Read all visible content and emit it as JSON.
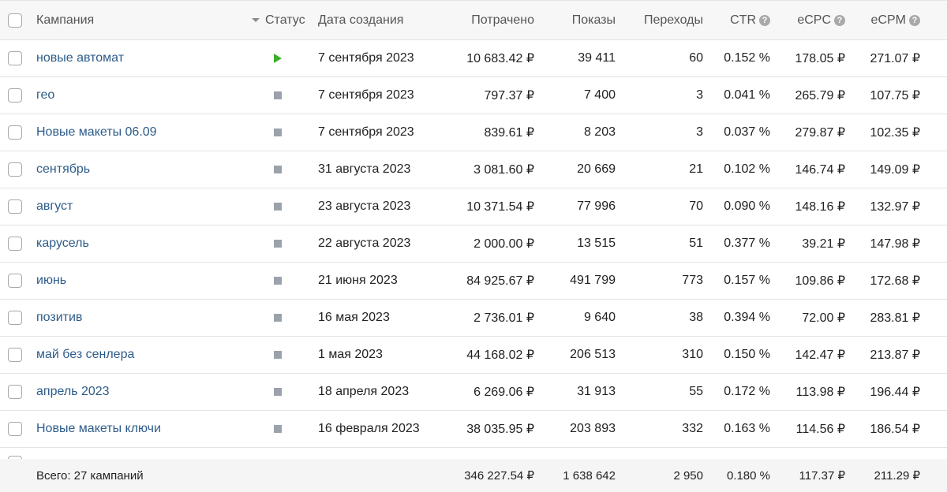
{
  "header": {
    "campaign": "Кампания",
    "status": "Статус",
    "date": "Дата создания",
    "spent": "Потрачено",
    "impressions": "Показы",
    "clicks": "Переходы",
    "ctr": "CTR",
    "ecpc": "eCPC",
    "ecpm": "eCPM",
    "help_glyph": "?"
  },
  "rows": [
    {
      "name": "новые автомат",
      "status": "play",
      "date": "7 сентября 2023",
      "spent": "10 683.42 ₽",
      "impressions": "39 411",
      "clicks": "60",
      "ctr": "0.152 %",
      "ecpc": "178.05 ₽",
      "ecpm": "271.07 ₽"
    },
    {
      "name": "гео",
      "status": "stop",
      "date": "7 сентября 2023",
      "spent": "797.37 ₽",
      "impressions": "7 400",
      "clicks": "3",
      "ctr": "0.041 %",
      "ecpc": "265.79 ₽",
      "ecpm": "107.75 ₽"
    },
    {
      "name": "Новые макеты 06.09",
      "status": "stop",
      "date": "7 сентября 2023",
      "spent": "839.61 ₽",
      "impressions": "8 203",
      "clicks": "3",
      "ctr": "0.037 %",
      "ecpc": "279.87 ₽",
      "ecpm": "102.35 ₽"
    },
    {
      "name": "сентябрь",
      "status": "stop",
      "date": "31 августа 2023",
      "spent": "3 081.60 ₽",
      "impressions": "20 669",
      "clicks": "21",
      "ctr": "0.102 %",
      "ecpc": "146.74 ₽",
      "ecpm": "149.09 ₽"
    },
    {
      "name": "август",
      "status": "stop",
      "date": "23 августа 2023",
      "spent": "10 371.54 ₽",
      "impressions": "77 996",
      "clicks": "70",
      "ctr": "0.090 %",
      "ecpc": "148.16 ₽",
      "ecpm": "132.97 ₽"
    },
    {
      "name": "карусель",
      "status": "stop",
      "date": "22 августа 2023",
      "spent": "2 000.00 ₽",
      "impressions": "13 515",
      "clicks": "51",
      "ctr": "0.377 %",
      "ecpc": "39.21 ₽",
      "ecpm": "147.98 ₽"
    },
    {
      "name": "июнь",
      "status": "stop",
      "date": "21 июня 2023",
      "spent": "84 925.67 ₽",
      "impressions": "491 799",
      "clicks": "773",
      "ctr": "0.157 %",
      "ecpc": "109.86 ₽",
      "ecpm": "172.68 ₽"
    },
    {
      "name": "позитив",
      "status": "stop",
      "date": "16 мая 2023",
      "spent": "2 736.01 ₽",
      "impressions": "9 640",
      "clicks": "38",
      "ctr": "0.394 %",
      "ecpc": "72.00 ₽",
      "ecpm": "283.81 ₽"
    },
    {
      "name": "май без сенлера",
      "status": "stop",
      "date": "1 мая 2023",
      "spent": "44 168.02 ₽",
      "impressions": "206 513",
      "clicks": "310",
      "ctr": "0.150 %",
      "ecpc": "142.47 ₽",
      "ecpm": "213.87 ₽"
    },
    {
      "name": "апрель 2023",
      "status": "stop",
      "date": "18 апреля 2023",
      "spent": "6 269.06 ₽",
      "impressions": "31 913",
      "clicks": "55",
      "ctr": "0.172 %",
      "ecpc": "113.98 ₽",
      "ecpm": "196.44 ₽"
    },
    {
      "name": "Новые макеты ключи",
      "status": "stop",
      "date": "16 февраля 2023",
      "spent": "38 035.95 ₽",
      "impressions": "203 893",
      "clicks": "332",
      "ctr": "0.163 %",
      "ecpc": "114.56 ₽",
      "ecpm": "186.54 ₽"
    }
  ],
  "footer": {
    "label": "Всего: 27 кампаний",
    "spent": "346 227.54 ₽",
    "impressions": "1 638 642",
    "clicks": "2 950",
    "ctr": "0.180 %",
    "ecpc": "117.37 ₽",
    "ecpm": "211.29 ₽"
  },
  "colors": {
    "link": "#2d5c8a",
    "status_running": "#3dae2b",
    "status_stopped": "#9ba2ab"
  }
}
